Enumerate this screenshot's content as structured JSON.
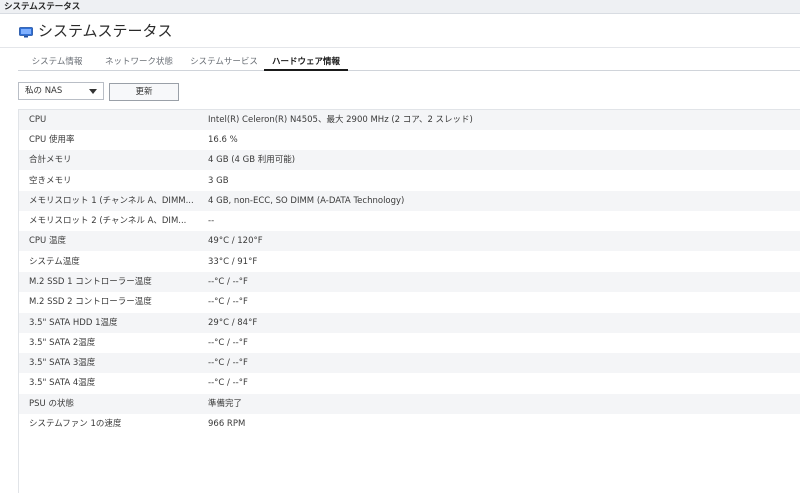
{
  "window": {
    "title": "システムステータス"
  },
  "header": {
    "title": "システムステータス",
    "icon": "monitor-icon",
    "accent": "#2f6fd6"
  },
  "tabs": [
    {
      "label": "システム情報",
      "active": false
    },
    {
      "label": "ネットワーク状態",
      "active": false
    },
    {
      "label": "システムサービス",
      "active": false
    },
    {
      "label": "ハードウェア情報",
      "active": true
    }
  ],
  "toolbar": {
    "device_select": "私の NAS",
    "refresh_label": "更新"
  },
  "hardware": [
    {
      "key": "CPU",
      "value": "Intel(R) Celeron(R) N4505、最大 2900 MHz (2 コア、2 スレッド)"
    },
    {
      "key": "CPU 使用率",
      "value": "16.6 %"
    },
    {
      "key": "合計メモリ",
      "value": "4 GB (4 GB 利用可能)"
    },
    {
      "key": "空きメモリ",
      "value": "3 GB"
    },
    {
      "key": "メモリスロット 1 (チャンネル A、DIMM...",
      "value": "4 GB, non-ECC, SO DIMM (A-DATA Technology)"
    },
    {
      "key": "メモリスロット 2 (チャンネル A、DIM...",
      "value": "--"
    },
    {
      "key": "CPU 温度",
      "value": "49°C / 120°F"
    },
    {
      "key": "システム温度",
      "value": "33°C / 91°F"
    },
    {
      "key": "M.2 SSD 1 コントローラー温度",
      "value": "--°C / --°F"
    },
    {
      "key": "M.2 SSD 2 コントローラー温度",
      "value": "--°C / --°F"
    },
    {
      "key": "3.5\" SATA HDD 1温度",
      "value": "29°C / 84°F"
    },
    {
      "key": "3.5\" SATA 2温度",
      "value": "--°C / --°F"
    },
    {
      "key": "3.5\" SATA 3温度",
      "value": "--°C / --°F"
    },
    {
      "key": "3.5\" SATA 4温度",
      "value": "--°C / --°F"
    },
    {
      "key": "PSU の状態",
      "value": "準備完了"
    },
    {
      "key": "システムファン 1の速度",
      "value": "966 RPM"
    }
  ]
}
